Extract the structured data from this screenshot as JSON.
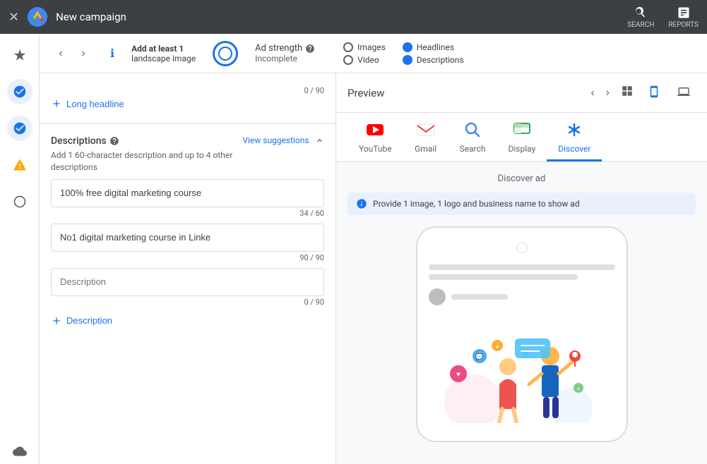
{
  "topBar": {
    "title": "New campaign",
    "searchLabel": "SEARCH",
    "reportsLabel": "REPORTS"
  },
  "adStrengthBar": {
    "landscapeText1": "Add at least 1",
    "landscapeText2": "landscape",
    "landscapeText3": "image",
    "adStrengthLabel": "Ad strength",
    "adStrengthStatus": "Incomplete",
    "checklistItems": {
      "images": "Images",
      "video": "Video",
      "headlines": "Headlines",
      "descriptions": "Descriptions"
    }
  },
  "leftPanel": {
    "longHeadlineLabel": "Long headline",
    "charCount": "0 / 90",
    "descriptionsTitle": "Descriptions",
    "descriptionsSubtitle": "Add 1 60-character description and up to 4 other descriptions",
    "viewSuggestions": "View suggestions",
    "description1Value": "100% free digital marketing course",
    "description1Count": "34 / 60",
    "description2Value": "No1 digital marketing course in Linke",
    "description2Count": "90 / 90",
    "description3Placeholder": "Description",
    "description3Count": "0 / 90",
    "addDescriptionLabel": "Description"
  },
  "preview": {
    "title": "Preview",
    "tabs": [
      {
        "id": "youtube",
        "label": "YouTube",
        "iconType": "youtube"
      },
      {
        "id": "gmail",
        "label": "Gmail",
        "iconType": "gmail"
      },
      {
        "id": "search",
        "label": "Search",
        "iconType": "search"
      },
      {
        "id": "display",
        "label": "Display",
        "iconType": "display"
      },
      {
        "id": "discover",
        "label": "Discover",
        "iconType": "discover",
        "active": true
      }
    ],
    "discoverAdTitle": "Discover ad",
    "discoverAdInfo": "Provide 1 image, 1 logo and business name to show ad"
  }
}
